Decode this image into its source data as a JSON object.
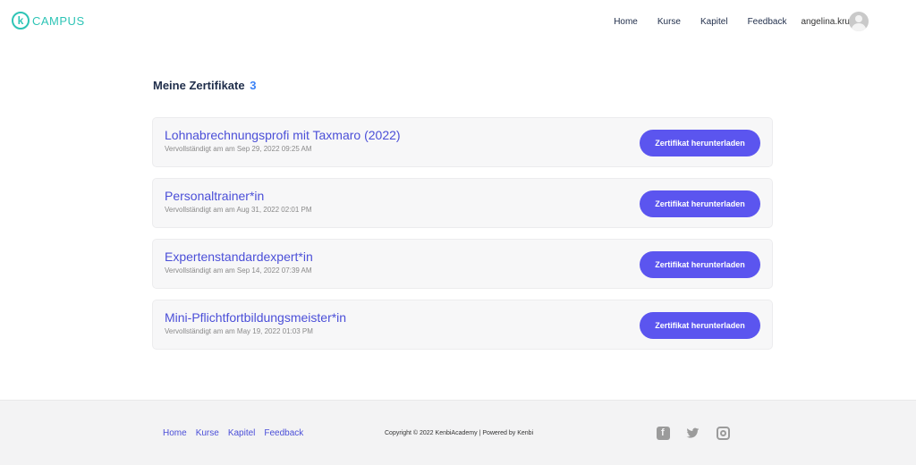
{
  "brand": {
    "logo_letter": "k",
    "name": "CAMPUS"
  },
  "nav": {
    "items": [
      "Home",
      "Kurse",
      "Kapitel",
      "Feedback"
    ],
    "username": "angelina.krueger"
  },
  "main": {
    "title": "Meine Zertifikate",
    "count": "3",
    "certificates": [
      {
        "name": "Lohnabrechnungsprofi mit Taxmaro (2022)",
        "completed": "Vervollständigt am am Sep 29, 2022 09:25 AM",
        "button": "Zertifikat herunterladen"
      },
      {
        "name": "Personaltrainer*in",
        "completed": "Vervollständigt am am Aug 31, 2022 02:01 PM",
        "button": "Zertifikat herunterladen"
      },
      {
        "name": "Expertenstandardexpert*in",
        "completed": "Vervollständigt am am Sep 14, 2022 07:39 AM",
        "button": "Zertifikat herunterladen"
      },
      {
        "name": "Mini-Pflichtfortbildungsmeister*in",
        "completed": "Vervollständigt am am May 19, 2022 01:03 PM",
        "button": "Zertifikat herunterladen"
      }
    ]
  },
  "footer": {
    "links": [
      "Home",
      "Kurse",
      "Kapitel",
      "Feedback"
    ],
    "copyright": "Copyright © 2022 KenbiAcademy | Powered by Kenbi",
    "social": [
      "facebook-icon",
      "twitter-icon",
      "instagram-icon"
    ]
  },
  "colors": {
    "accent": "#5b55ef",
    "brand": "#2ec4b6",
    "title_link": "#4b4fd8",
    "count": "#3b82f6"
  }
}
